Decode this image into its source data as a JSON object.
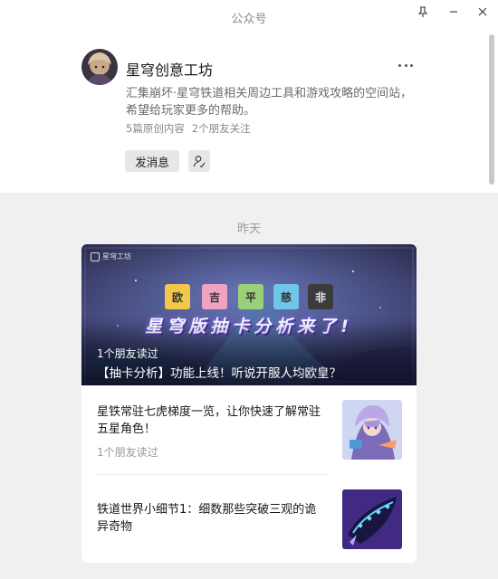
{
  "window": {
    "title": "公众号",
    "controls": [
      "pin-icon",
      "minimize-icon",
      "close-icon"
    ]
  },
  "account": {
    "name": "星穹创意工坊",
    "description": "汇集崩坏·星穹铁道相关周边工具和游戏攻略的空间站，希望给玩家更多的帮助。",
    "original_count": "5篇原创内容",
    "friends_following": "2个朋友关注",
    "send_message_label": "发消息",
    "more_icon": "ellipsis-icon",
    "follow_icon": "follow-user-icon"
  },
  "feed": {
    "date_label": "昨天",
    "hero": {
      "logo_text": "星穹工坊",
      "tiles": [
        "欧",
        "吉",
        "平",
        "慈",
        "非"
      ],
      "banner_text": "星穹版抽卡分析来了!",
      "read_by": "1个朋友读过",
      "title": "【抽卡分析】功能上线！听说开服人均欧皇？"
    },
    "articles": [
      {
        "title": "星铁常驻七虎梯度一览，让你快速了解常驻五星角色！",
        "read_by": "1个朋友读过"
      },
      {
        "title": "铁道世界小细节1：细数那些突破三观的诡异奇物",
        "read_by": ""
      }
    ]
  },
  "colors": {
    "window_bg": "#f0f0f0",
    "card_bg": "#ffffff",
    "muted_text": "#8a8a8a",
    "button_bg": "#e7e7e7"
  }
}
